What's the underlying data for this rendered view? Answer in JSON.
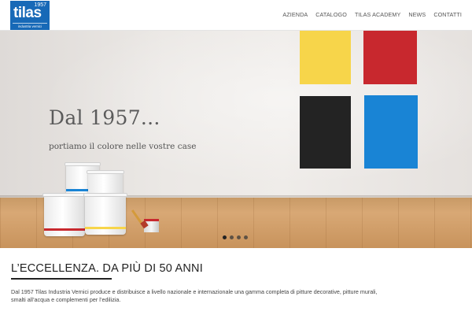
{
  "logo": {
    "year": "1957",
    "name": "tilas",
    "tagline": "industria vernici",
    "color": "#1769b7"
  },
  "nav": {
    "items": [
      "AZIENDA",
      "CATALOGO",
      "TILAS ACADEMY",
      "NEWS",
      "CONTATTI"
    ]
  },
  "hero": {
    "title": "Dal 1957...",
    "subtitle": "portiamo il colore nelle vostre case",
    "swatch_colors": [
      "#f7d54a",
      "#c8282e",
      "#232323",
      "#1984d5"
    ],
    "slider": {
      "slide_count": 4,
      "active_index": 0
    }
  },
  "about": {
    "heading": "L’ECCELLENZA. DA PIÙ DI 50 ANNI",
    "text": "Dal 1957 Tilas Industria Vernici produce e distribuisce a livello nazionale e internazionale una gamma completa di pitture decorative, pitture murali, smalti all’acqua e complementi per l’edilizia."
  }
}
